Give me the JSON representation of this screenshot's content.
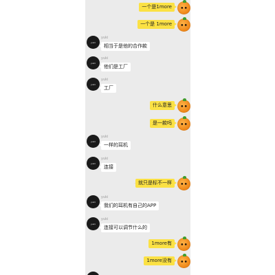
{
  "chat": {
    "messages": [
      {
        "side": "right",
        "text": "一个是1more",
        "meta": ""
      },
      {
        "side": "right",
        "text": "一个是 1more",
        "meta": ""
      },
      {
        "side": "left",
        "name": "yuki",
        "avatar_text": "yuki",
        "text": "相当于是他的合作款"
      },
      {
        "side": "left",
        "name": "yuki",
        "avatar_text": "yuki",
        "text": "他们是工厂"
      },
      {
        "side": "left",
        "name": "yuki",
        "avatar_text": "yuki",
        "text": "工厂"
      },
      {
        "side": "right",
        "text": "什么意思"
      },
      {
        "side": "right",
        "text": "是一款吗"
      },
      {
        "side": "left",
        "name": "yuki",
        "avatar_text": "yuki",
        "text": "一样的耳机"
      },
      {
        "side": "left",
        "name": "yuki",
        "avatar_text": "yuki",
        "text": "连接"
      },
      {
        "side": "right",
        "text": "就只是标不一样"
      },
      {
        "side": "left",
        "name": "yuki",
        "avatar_text": "yuki",
        "text": "我们的耳机有自己的APP"
      },
      {
        "side": "left",
        "name": "yuki",
        "avatar_text": "yuki",
        "text": "连接可以调节什么的"
      },
      {
        "side": "right",
        "text": "1more有"
      },
      {
        "side": "right",
        "text": "1more没有"
      }
    ]
  },
  "colors": {
    "chat_bg": "#ebebeb",
    "bubble_self": "#fbe144",
    "bubble_other": "#ffffff"
  },
  "icons": {
    "self_avatar": "orange-avatar-icon",
    "other_avatar": "black-logo-avatar-icon"
  }
}
